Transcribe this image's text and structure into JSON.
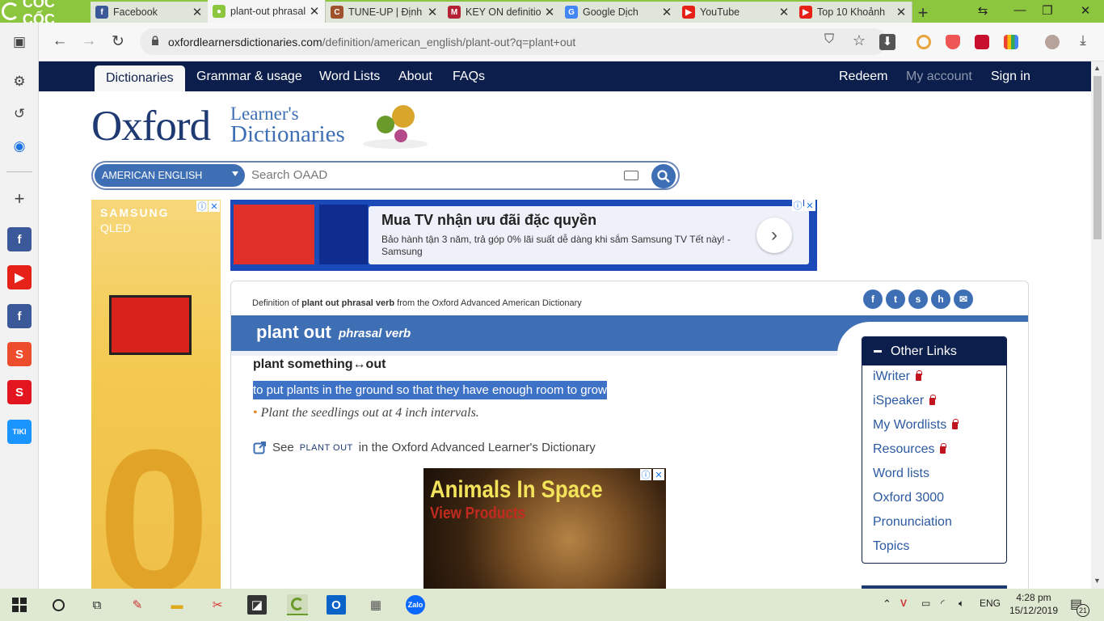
{
  "browser": {
    "brand": "CỐC CỐC",
    "tabs": [
      {
        "title": "Facebook",
        "icon": "facebook-icon",
        "color": "#3b5998",
        "glyph": "f"
      },
      {
        "title": "plant-out phrasal",
        "icon": "oxford-icon",
        "color": "#8cc63e",
        "glyph": "●"
      },
      {
        "title": "TUNE-UP | Định",
        "icon": "cambridge-icon",
        "color": "#a0522d",
        "glyph": "C"
      },
      {
        "title": "KEY ON definitio",
        "icon": "dictionary-icon",
        "color": "#b22234",
        "glyph": "M"
      },
      {
        "title": "Google Dịch",
        "icon": "google-translate-icon",
        "color": "#4285f4",
        "glyph": "G"
      },
      {
        "title": "YouTube",
        "icon": "youtube-icon",
        "color": "#e62117",
        "glyph": "▶"
      },
      {
        "title": "Top 10 Khoảnh",
        "icon": "youtube-icon",
        "color": "#e62117",
        "glyph": "▶"
      }
    ],
    "url_domain": "oxfordlearnersdictionaries.com",
    "url_path": "/definition/american_english/plant-out?q=plant+out"
  },
  "site": {
    "nav": {
      "dictionaries": "Dictionaries",
      "grammar": "Grammar & usage",
      "wordlists": "Word Lists",
      "about": "About",
      "faqs": "FAQs",
      "redeem": "Redeem",
      "account": "My account",
      "signin": "Sign in"
    },
    "logo": {
      "oxford": "Oxford",
      "learners": "Learner's",
      "dictionaries": "Dictionaries"
    },
    "search": {
      "dictionary": "AMERICAN ENGLISH",
      "placeholder": "Search OAAD"
    }
  },
  "ads": {
    "left": {
      "brand": "SAMSUNG",
      "product": "QLED",
      "big": "0"
    },
    "top": {
      "headline": "Mua TV nhận ưu đãi đặc quyền",
      "body": "Bảo hành tận 3 năm, trả góp 0% lãi suất dễ dàng khi sắm Samsung TV Tết này! - Samsung"
    },
    "bottom": {
      "title": "Animals In Space",
      "subtitle": "View Products"
    }
  },
  "entry": {
    "definition_prefix": "Definition of ",
    "definition_bold": "plant out phrasal verb",
    "definition_suffix": " from the Oxford Advanced American Dictionary",
    "headword": "plant out",
    "pos": "phrasal verb",
    "pattern": "plant something↔out",
    "sense": "to put plants in the ground so that they have enough room to grow",
    "example": "Plant the seedlings out at 4 inch intervals.",
    "see_prefix": "See",
    "see_link": "plant out",
    "see_suffix": "in the Oxford Advanced Learner's Dictionary"
  },
  "other_links": {
    "title": "Other Links",
    "items": [
      {
        "label": "iWriter",
        "locked": true
      },
      {
        "label": "iSpeaker",
        "locked": true
      },
      {
        "label": "My Wordlists",
        "locked": true
      },
      {
        "label": "Resources",
        "locked": true
      },
      {
        "label": "Word lists",
        "locked": false
      },
      {
        "label": "Oxford 3000",
        "locked": false
      },
      {
        "label": "Pronunciation",
        "locked": false
      },
      {
        "label": "Topics",
        "locked": false
      }
    ]
  },
  "taskbar": {
    "language": "ENG",
    "time": "4:28 pm",
    "date": "15/12/2019",
    "notifications": "21"
  },
  "sidebar_apps": [
    {
      "name": "facebook",
      "color": "#3b5998",
      "glyph": "f"
    },
    {
      "name": "youtube",
      "color": "#e62117",
      "glyph": "▶"
    },
    {
      "name": "facebook",
      "color": "#3b5998",
      "glyph": "f"
    },
    {
      "name": "shopee",
      "color": "#ee4d2d",
      "glyph": "S"
    },
    {
      "name": "sendo",
      "color": "#e3161f",
      "glyph": "S"
    },
    {
      "name": "tiki",
      "color": "#1a94ff",
      "glyph": "TIKI"
    }
  ]
}
